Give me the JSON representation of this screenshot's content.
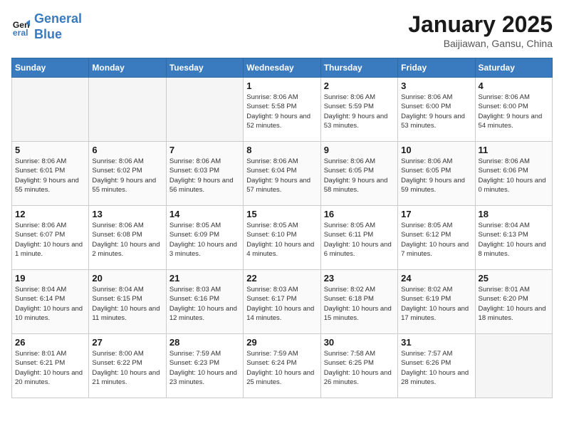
{
  "header": {
    "logo_line1": "General",
    "logo_line2": "Blue",
    "month_title": "January 2025",
    "location": "Baijiawan, Gansu, China"
  },
  "weekdays": [
    "Sunday",
    "Monday",
    "Tuesday",
    "Wednesday",
    "Thursday",
    "Friday",
    "Saturday"
  ],
  "weeks": [
    [
      {
        "day": "",
        "empty": true
      },
      {
        "day": "",
        "empty": true
      },
      {
        "day": "",
        "empty": true
      },
      {
        "day": "1",
        "sunrise": "8:06 AM",
        "sunset": "5:58 PM",
        "daylight": "9 hours and 52 minutes."
      },
      {
        "day": "2",
        "sunrise": "8:06 AM",
        "sunset": "5:59 PM",
        "daylight": "9 hours and 53 minutes."
      },
      {
        "day": "3",
        "sunrise": "8:06 AM",
        "sunset": "6:00 PM",
        "daylight": "9 hours and 53 minutes."
      },
      {
        "day": "4",
        "sunrise": "8:06 AM",
        "sunset": "6:00 PM",
        "daylight": "9 hours and 54 minutes."
      }
    ],
    [
      {
        "day": "5",
        "sunrise": "8:06 AM",
        "sunset": "6:01 PM",
        "daylight": "9 hours and 55 minutes."
      },
      {
        "day": "6",
        "sunrise": "8:06 AM",
        "sunset": "6:02 PM",
        "daylight": "9 hours and 55 minutes."
      },
      {
        "day": "7",
        "sunrise": "8:06 AM",
        "sunset": "6:03 PM",
        "daylight": "9 hours and 56 minutes."
      },
      {
        "day": "8",
        "sunrise": "8:06 AM",
        "sunset": "6:04 PM",
        "daylight": "9 hours and 57 minutes."
      },
      {
        "day": "9",
        "sunrise": "8:06 AM",
        "sunset": "6:05 PM",
        "daylight": "9 hours and 58 minutes."
      },
      {
        "day": "10",
        "sunrise": "8:06 AM",
        "sunset": "6:05 PM",
        "daylight": "9 hours and 59 minutes."
      },
      {
        "day": "11",
        "sunrise": "8:06 AM",
        "sunset": "6:06 PM",
        "daylight": "10 hours and 0 minutes."
      }
    ],
    [
      {
        "day": "12",
        "sunrise": "8:06 AM",
        "sunset": "6:07 PM",
        "daylight": "10 hours and 1 minute."
      },
      {
        "day": "13",
        "sunrise": "8:06 AM",
        "sunset": "6:08 PM",
        "daylight": "10 hours and 2 minutes."
      },
      {
        "day": "14",
        "sunrise": "8:05 AM",
        "sunset": "6:09 PM",
        "daylight": "10 hours and 3 minutes."
      },
      {
        "day": "15",
        "sunrise": "8:05 AM",
        "sunset": "6:10 PM",
        "daylight": "10 hours and 4 minutes."
      },
      {
        "day": "16",
        "sunrise": "8:05 AM",
        "sunset": "6:11 PM",
        "daylight": "10 hours and 6 minutes."
      },
      {
        "day": "17",
        "sunrise": "8:05 AM",
        "sunset": "6:12 PM",
        "daylight": "10 hours and 7 minutes."
      },
      {
        "day": "18",
        "sunrise": "8:04 AM",
        "sunset": "6:13 PM",
        "daylight": "10 hours and 8 minutes."
      }
    ],
    [
      {
        "day": "19",
        "sunrise": "8:04 AM",
        "sunset": "6:14 PM",
        "daylight": "10 hours and 10 minutes."
      },
      {
        "day": "20",
        "sunrise": "8:04 AM",
        "sunset": "6:15 PM",
        "daylight": "10 hours and 11 minutes."
      },
      {
        "day": "21",
        "sunrise": "8:03 AM",
        "sunset": "6:16 PM",
        "daylight": "10 hours and 12 minutes."
      },
      {
        "day": "22",
        "sunrise": "8:03 AM",
        "sunset": "6:17 PM",
        "daylight": "10 hours and 14 minutes."
      },
      {
        "day": "23",
        "sunrise": "8:02 AM",
        "sunset": "6:18 PM",
        "daylight": "10 hours and 15 minutes."
      },
      {
        "day": "24",
        "sunrise": "8:02 AM",
        "sunset": "6:19 PM",
        "daylight": "10 hours and 17 minutes."
      },
      {
        "day": "25",
        "sunrise": "8:01 AM",
        "sunset": "6:20 PM",
        "daylight": "10 hours and 18 minutes."
      }
    ],
    [
      {
        "day": "26",
        "sunrise": "8:01 AM",
        "sunset": "6:21 PM",
        "daylight": "10 hours and 20 minutes."
      },
      {
        "day": "27",
        "sunrise": "8:00 AM",
        "sunset": "6:22 PM",
        "daylight": "10 hours and 21 minutes."
      },
      {
        "day": "28",
        "sunrise": "7:59 AM",
        "sunset": "6:23 PM",
        "daylight": "10 hours and 23 minutes."
      },
      {
        "day": "29",
        "sunrise": "7:59 AM",
        "sunset": "6:24 PM",
        "daylight": "10 hours and 25 minutes."
      },
      {
        "day": "30",
        "sunrise": "7:58 AM",
        "sunset": "6:25 PM",
        "daylight": "10 hours and 26 minutes."
      },
      {
        "day": "31",
        "sunrise": "7:57 AM",
        "sunset": "6:26 PM",
        "daylight": "10 hours and 28 minutes."
      },
      {
        "day": "",
        "empty": true
      }
    ]
  ]
}
